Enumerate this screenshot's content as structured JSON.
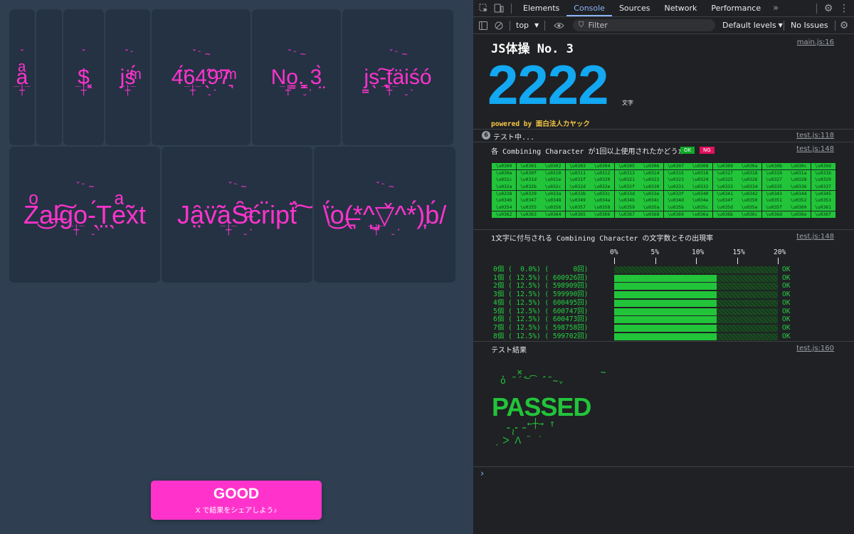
{
  "app": {
    "row1": [
      {
        "text": "a",
        "w": 36
      },
      {
        "text": "",
        "w": 36
      },
      {
        "text": "$",
        "w": 57
      },
      {
        "text": "js",
        "w": 63
      },
      {
        "text": "46497",
        "w": 139
      },
      {
        "text": "No. 3",
        "w": 125
      },
      {
        "text": "js-taiso",
        "w": 156
      }
    ],
    "row2": [
      {
        "text": "Zalgo-Text",
        "w": 212
      },
      {
        "text": "JavaScript",
        "w": 212
      },
      {
        "text": "\\o(*^▽^*)b/",
        "w": 199
      }
    ],
    "good_button": {
      "label": "GOOD",
      "sub": "X で結果をシェアしよう♪"
    }
  },
  "devtools": {
    "tabs": [
      "Elements",
      "Console",
      "Sources",
      "Network",
      "Performance"
    ],
    "active_tab": "Console",
    "toolbar": {
      "context": "top",
      "filter_placeholder": "Filter",
      "levels": "Default levels",
      "issues": "No Issues"
    },
    "header": {
      "title": "JS体操 No. 3",
      "count": "2222",
      "unit": "文字",
      "powered": "powered by 面白法人カヤック",
      "src": "main.js:16"
    },
    "group": {
      "count": "6",
      "text": "テスト中...",
      "src": "test.js:118"
    },
    "check": {
      "text": "各 Combining Character が1回以上使用されたかどうか",
      "ok": "OK",
      "ng": "NG",
      "src": "test.js:148"
    },
    "codes": [
      "\\u0300",
      "\\u0301",
      "\\u0302",
      "\\u0303",
      "\\u0304",
      "\\u0305",
      "\\u0306",
      "\\u0307",
      "\\u0308",
      "\\u0309",
      "\\u030a",
      "\\u030b",
      "\\u030c",
      "\\u030d",
      "\\u030e",
      "\\u030f",
      "\\u0310",
      "\\u0311",
      "\\u0312",
      "\\u0313",
      "\\u0314",
      "\\u0315",
      "\\u0316",
      "\\u0317",
      "\\u0318",
      "\\u0319",
      "\\u031a",
      "\\u031b",
      "\\u031c",
      "\\u031d",
      "\\u031e",
      "\\u031f",
      "\\u0320",
      "\\u0321",
      "\\u0322",
      "\\u0323",
      "\\u0324",
      "\\u0325",
      "\\u0326",
      "\\u0327",
      "\\u0328",
      "\\u0329",
      "\\u032a",
      "\\u032b",
      "\\u032c",
      "\\u032d",
      "\\u032e",
      "\\u032f",
      "\\u0330",
      "\\u0331",
      "\\u0332",
      "\\u0333",
      "\\u0334",
      "\\u0335",
      "\\u0336",
      "\\u0337",
      "\\u0338",
      "\\u0339",
      "\\u033a",
      "\\u033b",
      "\\u033c",
      "\\u033d",
      "\\u033e",
      "\\u033f",
      "\\u0340",
      "\\u0341",
      "\\u0342",
      "\\u0343",
      "\\u0344",
      "\\u0345",
      "\\u0346",
      "\\u0347",
      "\\u0348",
      "\\u0349",
      "\\u034a",
      "\\u034b",
      "\\u034c",
      "\\u034d",
      "\\u034e",
      "\\u034f",
      "\\u0350",
      "\\u0351",
      "\\u0352",
      "\\u0353",
      "\\u0354",
      "\\u0355",
      "\\u0356",
      "\\u0357",
      "\\u0358",
      "\\u0359",
      "\\u035a",
      "\\u035b",
      "\\u035c",
      "\\u035d",
      "\\u035e",
      "\\u035f",
      "\\u0360",
      "\\u0361",
      "\\u0362",
      "\\u0363",
      "\\u0364",
      "\\u0365",
      "\\u0366",
      "\\u0367",
      "\\u0368",
      "\\u0369",
      "\\u036a",
      "\\u036b",
      "\\u036c",
      "\\u036d",
      "\\u036e",
      "\\u036f"
    ],
    "dist": {
      "text": "1文字に付与される Combining Character の文字数とその出現率",
      "src": "test.js:148",
      "axis": [
        "0%",
        "5%",
        "10%",
        "15%",
        "20%"
      ],
      "rows": [
        {
          "label": "0個 (  0.0%) (      0回)",
          "pct": 0.0,
          "ok": "OK"
        },
        {
          "label": "1個 ( 12.5%) ( 600926回)",
          "pct": 12.5,
          "ok": "OK"
        },
        {
          "label": "2個 ( 12.5%) ( 598909回)",
          "pct": 12.5,
          "ok": "OK"
        },
        {
          "label": "3個 ( 12.5%) ( 599990回)",
          "pct": 12.5,
          "ok": "OK"
        },
        {
          "label": "4個 ( 12.5%) ( 600495回)",
          "pct": 12.5,
          "ok": "OK"
        },
        {
          "label": "5個 ( 12.5%) ( 600747回)",
          "pct": 12.5,
          "ok": "OK"
        },
        {
          "label": "6個 ( 12.5%) ( 600473回)",
          "pct": 12.5,
          "ok": "OK"
        },
        {
          "label": "7個 ( 12.5%) ( 598758回)",
          "pct": 12.5,
          "ok": "OK"
        },
        {
          "label": "8個 ( 12.5%) ( 599702回)",
          "pct": 12.5,
          "ok": "OK"
        }
      ],
      "max_pct": 20
    },
    "result": {
      "text": "テスト結果",
      "src": "test.js:160",
      "passed": "PASSED"
    },
    "prompt": "›"
  }
}
